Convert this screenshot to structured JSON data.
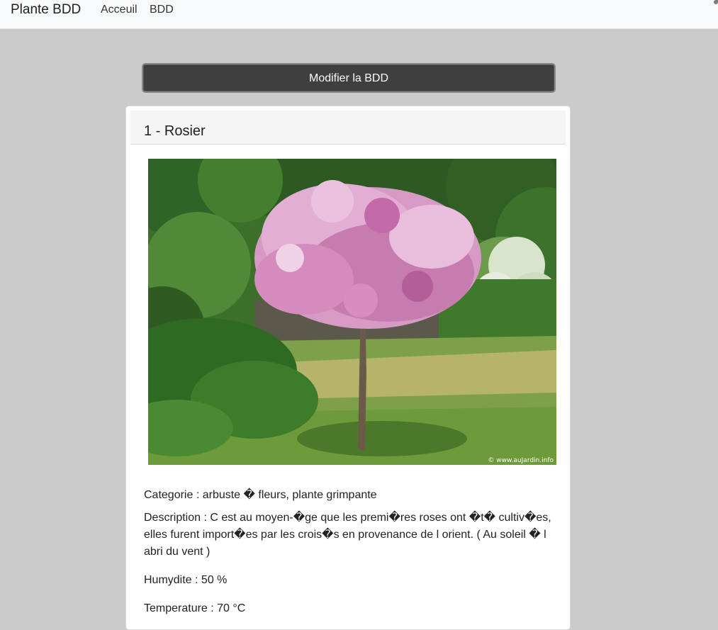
{
  "navbar": {
    "brand": "Plante BDD",
    "links": [
      "Acceuil",
      "BDD"
    ]
  },
  "toolbar": {
    "modify_label": "Modifier la BDD"
  },
  "plant": {
    "title": "1 - Rosier",
    "image_watermark": "© www.auJardin.info",
    "category": "Categorie : arbuste � fleurs, plante grimpante",
    "description": "Description : C est au moyen-�ge que les premi�res roses ont �t� cultiv�es, elles furent import�es par les crois�s en provenance de l orient. ( Au soleil � l abri du vent )",
    "humidity": "Humydite : 50 %",
    "temperature": "Temperature : 70 °C"
  },
  "colors": {
    "background": "#cbcbcb",
    "navbar": "#f8f9fa",
    "button": "#3f3f3f",
    "card": "#ffffff"
  }
}
